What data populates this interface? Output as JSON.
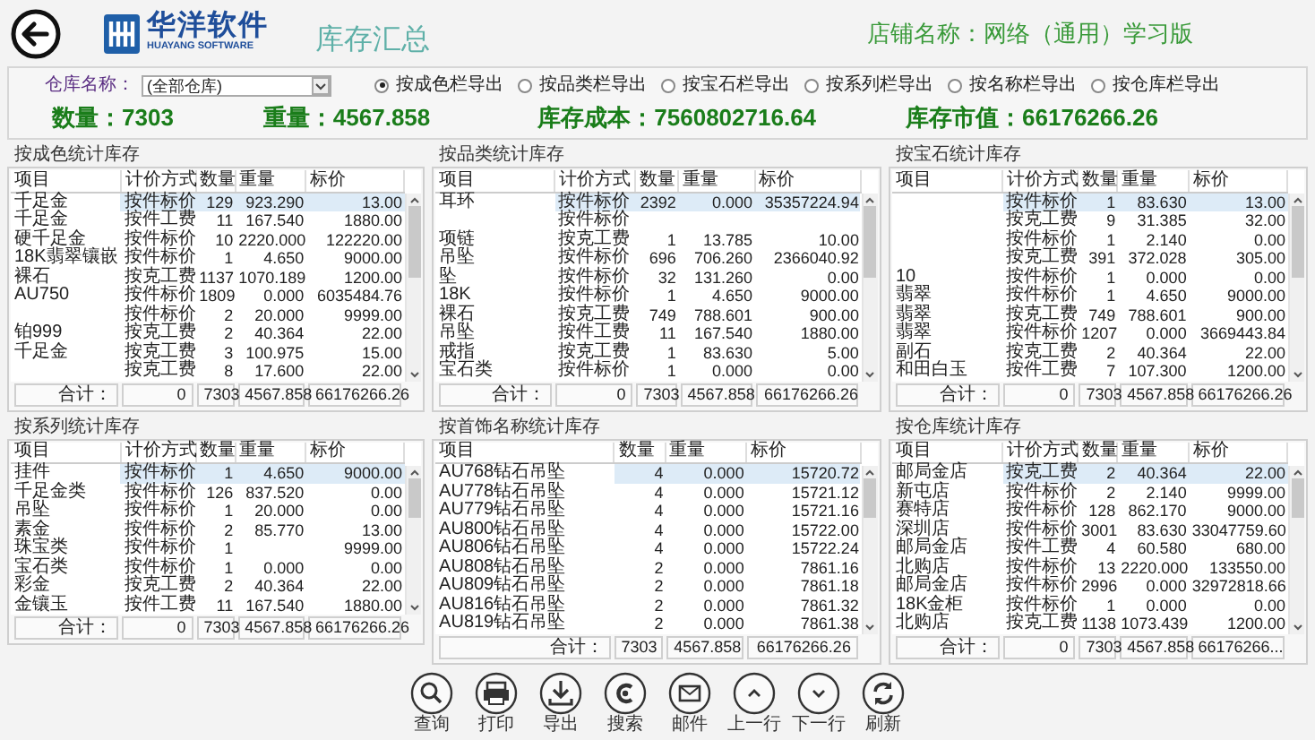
{
  "header": {
    "logo_name": "华洋软件",
    "logo_tagline": "HUAYANG SOFTWARE",
    "title": "库存汇总",
    "store": "店铺名称：网络（通用）学习版"
  },
  "filter": {
    "warehouse_label": "仓库名称：",
    "warehouse_value": "(全部仓库)",
    "export_options": [
      {
        "label": "按成色栏导出",
        "selected": true
      },
      {
        "label": "按品类栏导出",
        "selected": false
      },
      {
        "label": "按宝石栏导出",
        "selected": false
      },
      {
        "label": "按系列栏导出",
        "selected": false
      },
      {
        "label": "按名称栏导出",
        "selected": false
      },
      {
        "label": "按仓库栏导出",
        "selected": false
      }
    ]
  },
  "summary": [
    "数量：7303",
    "重量：4567.858",
    "库存成本：7560802716.64",
    "库存市值：66176266.26"
  ],
  "panels": [
    {
      "title": "按成色统计库存",
      "columns": [
        {
          "label": "项目",
          "kind": "text"
        },
        {
          "label": "计价方式",
          "kind": "text"
        },
        {
          "label": "数量",
          "kind": "number"
        },
        {
          "label": "重量",
          "kind": "number"
        },
        {
          "label": "标价",
          "kind": "number"
        }
      ],
      "rows": [
        {
          "cells": [
            "千足金",
            "按件标价",
            "129",
            "923.290",
            "13.00"
          ],
          "selected": true
        },
        {
          "cells": [
            "千足金",
            "按件工费",
            "11",
            "167.540",
            "1880.00"
          ],
          "selected": false
        },
        {
          "cells": [
            "硬千足金",
            "按件标价",
            "10",
            "2220.000",
            "122220.00"
          ],
          "selected": false
        },
        {
          "cells": [
            "18K翡翠镶嵌",
            "按件标价",
            "1",
            "4.650",
            "9000.00"
          ],
          "selected": false
        },
        {
          "cells": [
            "裸石",
            "按克工费",
            "1137",
            "1070.189",
            "1200.00"
          ],
          "selected": false
        },
        {
          "cells": [
            "AU750",
            "按件标价",
            "1809",
            "0.000",
            "6035484.76"
          ],
          "selected": false
        },
        {
          "cells": [
            null,
            "按件标价",
            "2",
            "20.000",
            "9999.00"
          ],
          "selected": false
        },
        {
          "cells": [
            "铂999",
            "按克工费",
            "2",
            "40.364",
            "22.00"
          ],
          "selected": false
        },
        {
          "cells": [
            "千足金",
            "按克工费",
            "3",
            "100.975",
            "15.00"
          ],
          "selected": false
        },
        {
          "cells": [
            null,
            "按克工费",
            "8",
            "17.600",
            "22.00"
          ],
          "selected": false
        }
      ],
      "footer": [
        "合计：",
        "0",
        "7303",
        "4567.858",
        "66176266.26"
      ]
    },
    {
      "title": "按品类统计库存",
      "columns": [
        {
          "label": "项目",
          "kind": "text"
        },
        {
          "label": "计价方式",
          "kind": "text"
        },
        {
          "label": "数量",
          "kind": "number"
        },
        {
          "label": "重量",
          "kind": "number"
        },
        {
          "label": "标价",
          "kind": "number"
        }
      ],
      "rows": [
        {
          "cells": [
            "耳环",
            "按件标价",
            "2392",
            "0.000",
            "35357224.94"
          ],
          "selected": true
        },
        {
          "cells": [
            null,
            "按件标价",
            null,
            null,
            null
          ],
          "selected": false
        },
        {
          "cells": [
            "项链",
            "按克工费",
            "1",
            "13.785",
            "10.00"
          ],
          "selected": false
        },
        {
          "cells": [
            "吊坠",
            "按件标价",
            "696",
            "706.260",
            "2366040.92"
          ],
          "selected": false
        },
        {
          "cells": [
            "坠",
            "按件标价",
            "32",
            "131.260",
            "0.00"
          ],
          "selected": false
        },
        {
          "cells": [
            "18K",
            "按件标价",
            "1",
            "4.650",
            "9000.00"
          ],
          "selected": false
        },
        {
          "cells": [
            "裸石",
            "按克工费",
            "749",
            "788.601",
            "900.00"
          ],
          "selected": false
        },
        {
          "cells": [
            "吊坠",
            "按件工费",
            "11",
            "167.540",
            "1880.00"
          ],
          "selected": false
        },
        {
          "cells": [
            "戒指",
            "按克工费",
            "1",
            "83.630",
            "5.00"
          ],
          "selected": false
        },
        {
          "cells": [
            "宝石类",
            "按件标价",
            "1",
            "0.000",
            "0.00"
          ],
          "selected": false
        }
      ],
      "footer": [
        "合计：",
        "0",
        "7303",
        "4567.858",
        "66176266.26"
      ]
    },
    {
      "title": "按宝石统计库存",
      "columns": [
        {
          "label": "项目",
          "kind": "text"
        },
        {
          "label": "计价方式",
          "kind": "text"
        },
        {
          "label": "数量",
          "kind": "number"
        },
        {
          "label": "重量",
          "kind": "number"
        },
        {
          "label": "标价",
          "kind": "number"
        }
      ],
      "rows": [
        {
          "cells": [
            null,
            "按件标价",
            "1",
            "83.630",
            "13.00"
          ],
          "selected": true
        },
        {
          "cells": [
            null,
            "按克工费",
            "9",
            "31.385",
            "32.00"
          ],
          "selected": false
        },
        {
          "cells": [
            null,
            "按件标价",
            "1",
            "2.140",
            "0.00"
          ],
          "selected": false
        },
        {
          "cells": [
            null,
            "按克工费",
            "391",
            "372.028",
            "305.00"
          ],
          "selected": false
        },
        {
          "cells": [
            "10",
            "按件标价",
            "1",
            "0.000",
            "0.00"
          ],
          "selected": false
        },
        {
          "cells": [
            "翡翠",
            "按件标价",
            "1",
            "4.650",
            "9000.00"
          ],
          "selected": false
        },
        {
          "cells": [
            "翡翠",
            "按克工费",
            "749",
            "788.601",
            "900.00"
          ],
          "selected": false
        },
        {
          "cells": [
            "翡翠",
            "按件标价",
            "1207",
            "0.000",
            "3669443.84"
          ],
          "selected": false
        },
        {
          "cells": [
            "副石",
            "按克工费",
            "2",
            "40.364",
            "22.00"
          ],
          "selected": false
        },
        {
          "cells": [
            "和田白玉",
            "按件工费",
            "7",
            "107.300",
            "1200.00"
          ],
          "selected": false
        }
      ],
      "footer": [
        "合计：",
        "0",
        "7303",
        "4567.858",
        "66176266.26"
      ]
    },
    {
      "title": "按系列统计库存",
      "columns": [
        {
          "label": "项目",
          "kind": "text"
        },
        {
          "label": "计价方式",
          "kind": "text"
        },
        {
          "label": "数量",
          "kind": "number"
        },
        {
          "label": "重量",
          "kind": "number"
        },
        {
          "label": "标价",
          "kind": "number"
        }
      ],
      "rows": [
        {
          "cells": [
            "挂件",
            "按件标价",
            "1",
            "4.650",
            "9000.00"
          ],
          "selected": true
        },
        {
          "cells": [
            "千足金类",
            "按件标价",
            "126",
            "837.520",
            "0.00"
          ],
          "selected": false
        },
        {
          "cells": [
            "吊坠",
            "按件标价",
            "1",
            "20.000",
            "0.00"
          ],
          "selected": false
        },
        {
          "cells": [
            "素金",
            "按件标价",
            "2",
            "85.770",
            "13.00"
          ],
          "selected": false
        },
        {
          "cells": [
            "珠宝类",
            "按件标价",
            "1",
            null,
            "9999.00"
          ],
          "selected": false
        },
        {
          "cells": [
            "宝石类",
            "按件标价",
            "1",
            "0.000",
            "0.00"
          ],
          "selected": false
        },
        {
          "cells": [
            "彩金",
            "按克工费",
            "2",
            "40.364",
            "22.00"
          ],
          "selected": false
        },
        {
          "cells": [
            "金镶玉",
            "按件工费",
            "11",
            "167.540",
            "1880.00"
          ],
          "selected": false
        }
      ],
      "footer": [
        "合计：",
        "0",
        "7303",
        "4567.858",
        "66176266.26"
      ]
    },
    {
      "title": "按首饰名称统计库存",
      "columns": [
        {
          "label": "项目",
          "kind": "text"
        },
        {
          "label": "数量",
          "kind": "number"
        },
        {
          "label": "重量",
          "kind": "number"
        },
        {
          "label": "标价",
          "kind": "number"
        }
      ],
      "rows": [
        {
          "cells": [
            "AU768钻石吊坠",
            "4",
            "0.000",
            "15720.72"
          ],
          "selected": true
        },
        {
          "cells": [
            "AU778钻石吊坠",
            "4",
            "0.000",
            "15721.12"
          ],
          "selected": false
        },
        {
          "cells": [
            "AU779钻石吊坠",
            "4",
            "0.000",
            "15721.16"
          ],
          "selected": false
        },
        {
          "cells": [
            "AU800钻石吊坠",
            "4",
            "0.000",
            "15722.00"
          ],
          "selected": false
        },
        {
          "cells": [
            "AU806钻石吊坠",
            "4",
            "0.000",
            "15722.24"
          ],
          "selected": false
        },
        {
          "cells": [
            "AU808钻石吊坠",
            "2",
            "0.000",
            "7861.16"
          ],
          "selected": false
        },
        {
          "cells": [
            "AU809钻石吊坠",
            "2",
            "0.000",
            "7861.18"
          ],
          "selected": false
        },
        {
          "cells": [
            "AU816钻石吊坠",
            "2",
            "0.000",
            "7861.32"
          ],
          "selected": false
        },
        {
          "cells": [
            "AU819钻石吊坠",
            "2",
            "0.000",
            "7861.38"
          ],
          "selected": false
        }
      ],
      "footer": [
        "合计：",
        "7303",
        "4567.858",
        "66176266.26"
      ]
    },
    {
      "title": "按仓库统计库存",
      "columns": [
        {
          "label": "项目",
          "kind": "text"
        },
        {
          "label": "计价方式",
          "kind": "text"
        },
        {
          "label": "数量",
          "kind": "number"
        },
        {
          "label": "重量",
          "kind": "number"
        },
        {
          "label": "标价",
          "kind": "number"
        }
      ],
      "rows": [
        {
          "cells": [
            "邮局金店",
            "按克工费",
            "2",
            "40.364",
            "22.00"
          ],
          "selected": true
        },
        {
          "cells": [
            "新屯店",
            "按件标价",
            "2",
            "2.140",
            "9999.00"
          ],
          "selected": false
        },
        {
          "cells": [
            "赛特店",
            "按件标价",
            "128",
            "862.170",
            "9000.00"
          ],
          "selected": false
        },
        {
          "cells": [
            "深圳店",
            "按件标价",
            "3001",
            "83.630",
            "33047759.60"
          ],
          "selected": false
        },
        {
          "cells": [
            "邮局金店",
            "按件工费",
            "4",
            "60.580",
            "680.00"
          ],
          "selected": false
        },
        {
          "cells": [
            "北购店",
            "按件标价",
            "13",
            "2220.000",
            "133550.00"
          ],
          "selected": false
        },
        {
          "cells": [
            "邮局金店",
            "按件标价",
            "2996",
            "0.000",
            "32972818.66"
          ],
          "selected": false
        },
        {
          "cells": [
            "18K金柜",
            "按件标价",
            "1",
            "0.000",
            "0.00"
          ],
          "selected": false
        },
        {
          "cells": [
            "北购店",
            "按克工费",
            "1138",
            "1073.439",
            "1200.00"
          ],
          "selected": false
        }
      ],
      "footer": [
        "合计：",
        "0",
        "7303",
        "4567.858",
        "66176266..."
      ]
    }
  ],
  "toolbar": [
    {
      "label": "查询",
      "kind": "search"
    },
    {
      "label": "打印",
      "kind": "print"
    },
    {
      "label": "导出",
      "kind": "export"
    },
    {
      "label": "搜索",
      "kind": "swirl"
    },
    {
      "label": "邮件",
      "kind": "mail"
    },
    {
      "label": "上一行",
      "kind": "up"
    },
    {
      "label": "下一行",
      "kind": "down"
    },
    {
      "label": "刷新",
      "kind": "refresh"
    }
  ]
}
